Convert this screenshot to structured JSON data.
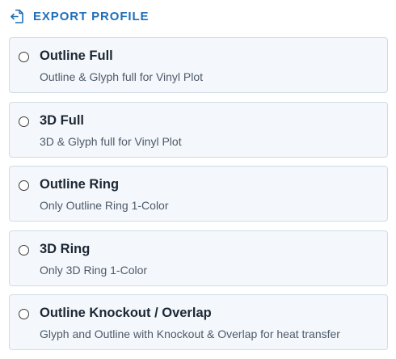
{
  "section": {
    "title": "EXPORT PROFILE",
    "icon": "file-export-icon",
    "accent_color": "#1f6fb8"
  },
  "options": [
    {
      "title": "Outline Full",
      "description": "Outline & Glyph full for Vinyl Plot",
      "selected": false
    },
    {
      "title": "3D Full",
      "description": "3D & Glyph full for Vinyl Plot",
      "selected": false
    },
    {
      "title": "Outline Ring",
      "description": "Only Outline Ring 1-Color",
      "selected": false
    },
    {
      "title": "3D Ring",
      "description": "Only 3D Ring 1-Color",
      "selected": false
    },
    {
      "title": "Outline Knockout / Overlap",
      "description": "Glyph and Outline with Knockout & Overlap for heat transfer",
      "selected": false
    }
  ]
}
